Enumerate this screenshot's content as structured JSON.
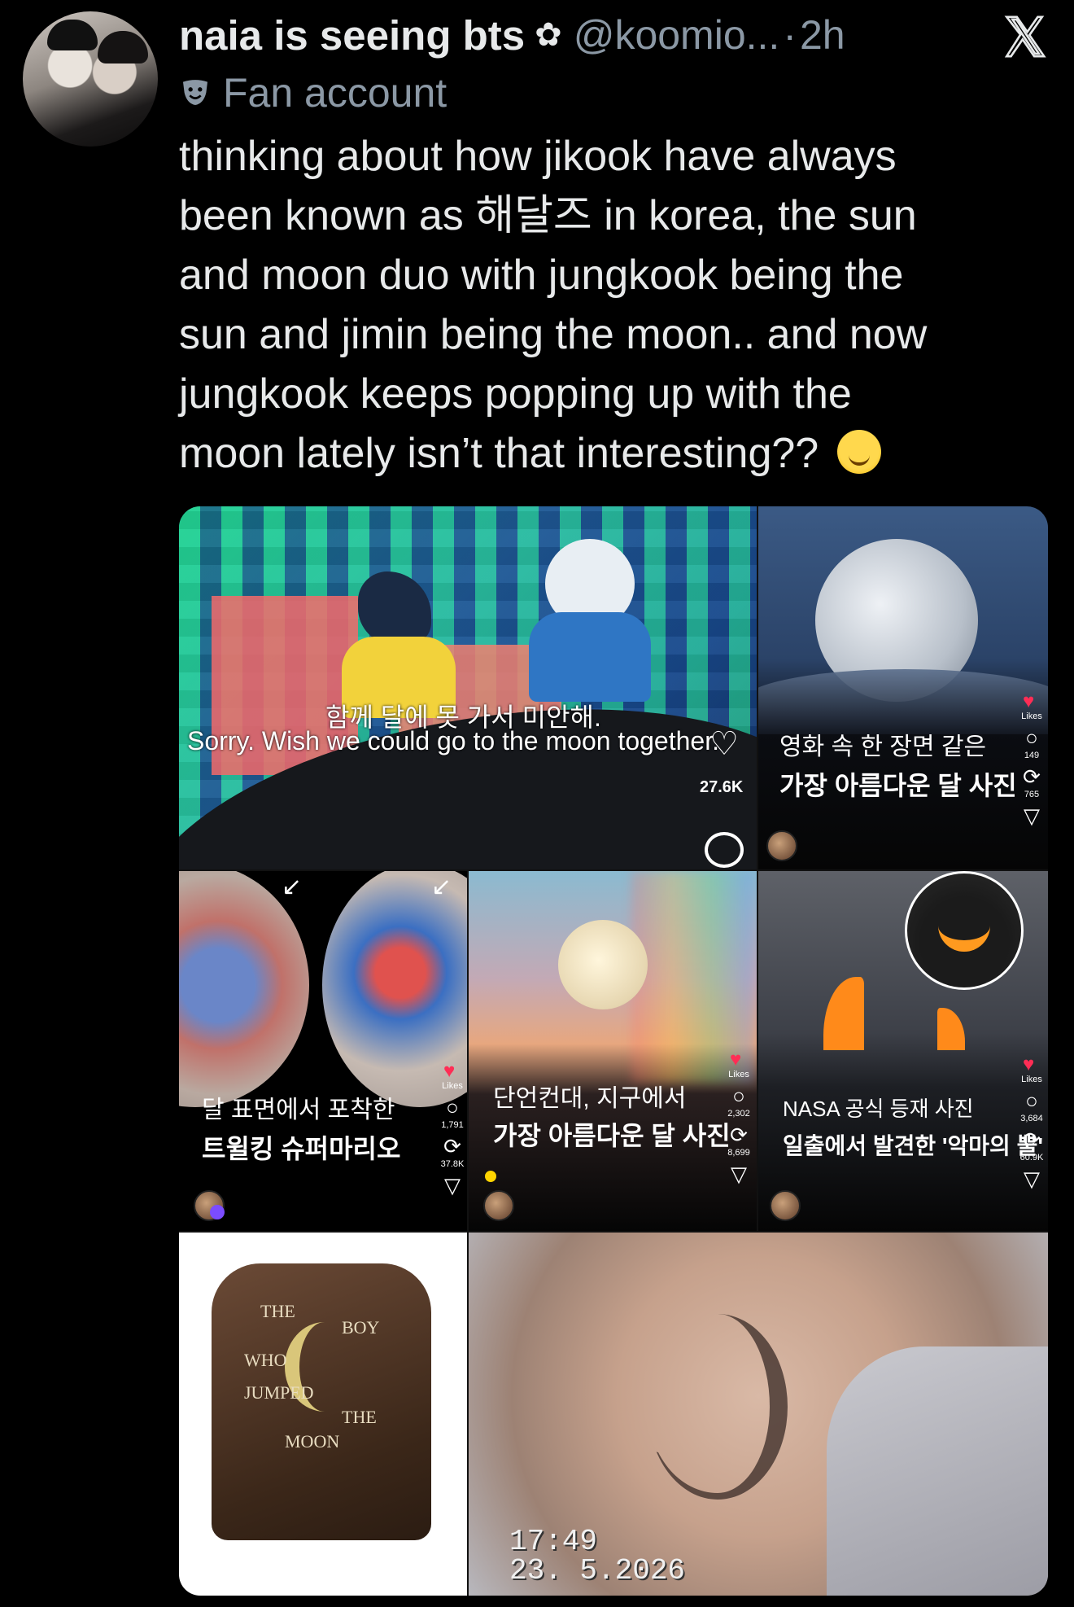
{
  "tweet": {
    "display_name": "naia is seeing bts",
    "name_icon": "flower-icon",
    "handle": "@koomio...",
    "time": "2h",
    "account_label": "Fan account",
    "text": "thinking about how jikook have always\nbeen known as 해달즈 in korea, the sun\nand moon duo with jungkook being the\nsun and jimin being the moon.. and now\njungkook keeps popping up with the\nmoon lately isn’t that interesting??",
    "emoji": "relieved-face-emoji"
  },
  "media": {
    "tile1": {
      "caption_ko": "함께 달에 못 가서 미안해.",
      "caption_en": "Sorry. Wish we could go to the moon together.",
      "likes": "27.6K"
    },
    "tile2": {
      "line1": "영화 속 한 장면 같은",
      "line2": "가장 아름다운 달 사진",
      "likes_label": "Likes",
      "comments": "149",
      "reposts": "765"
    },
    "tile3": {
      "line1": "달 표면에서 포착한",
      "line2": "트윌킹 슈퍼마리오",
      "likes_label": "Likes",
      "comments": "1,791",
      "reposts": "37.8K"
    },
    "tile4": {
      "line1": "단언컨대, 지구에서",
      "line2": "가장 아름다운 달 사진",
      "likes_label": "Likes",
      "comments": "2,302",
      "reposts": "8,699"
    },
    "tile5": {
      "line1": "NASA 공식 등재 사진",
      "line2": "일출에서 발견한 '악마의 뿔'",
      "likes_label": "Likes",
      "comments": "3,684",
      "reposts": "60.9K"
    },
    "tile6": {
      "jacket_words": [
        "THE",
        "BOY",
        "WHO",
        "JUMPED",
        "THE",
        "MOON"
      ]
    },
    "tile7": {
      "time_stamp": "17:49",
      "date_stamp": "23. 5.2026"
    }
  },
  "colors": {
    "background": "#000000",
    "text_primary": "#e7e9ea",
    "text_secondary": "#8b98a5",
    "like_red": "#ff2d55"
  }
}
